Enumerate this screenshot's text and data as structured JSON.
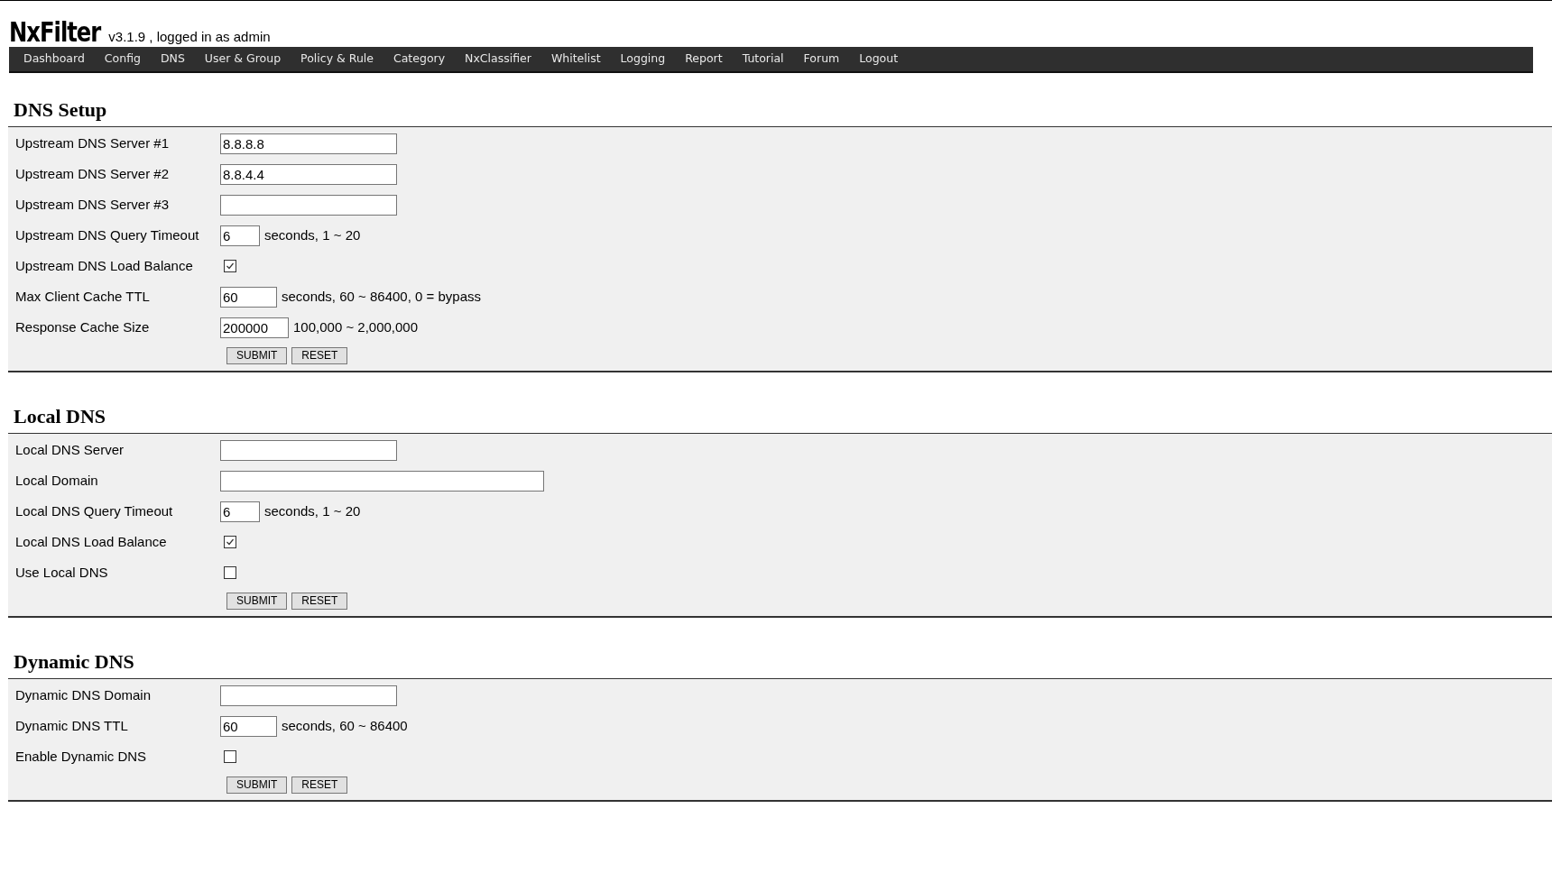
{
  "header": {
    "logo": "NxFilter",
    "info": "v3.1.9 , logged in as admin"
  },
  "nav": [
    "Dashboard",
    "Config",
    "DNS",
    "User & Group",
    "Policy & Rule",
    "Category",
    "NxClassifier",
    "Whitelist",
    "Logging",
    "Report",
    "Tutorial",
    "Forum",
    "Logout"
  ],
  "sections": [
    {
      "title": "DNS Setup",
      "rows": [
        {
          "kind": "text",
          "label": "Upstream DNS Server #1",
          "value": "8.8.8.8"
        },
        {
          "kind": "text",
          "label": "Upstream DNS Server #2",
          "value": "8.8.4.4"
        },
        {
          "kind": "text",
          "label": "Upstream DNS Server #3",
          "value": ""
        },
        {
          "kind": "number",
          "label": "Upstream DNS Query Timeout",
          "value": "6",
          "hint": "seconds, 1 ~ 20"
        },
        {
          "kind": "checkbox",
          "label": "Upstream DNS Load Balance",
          "checked": true
        },
        {
          "kind": "number",
          "label": "Max Client Cache TTL",
          "value": "60",
          "hint": "seconds, 60 ~ 86400, 0 = bypass"
        },
        {
          "kind": "number",
          "label": "Response Cache Size",
          "value": "200000",
          "hint": "100,000 ~ 2,000,000"
        }
      ],
      "buttons": [
        "SUBMIT",
        "RESET"
      ]
    },
    {
      "title": "Local DNS",
      "rows": [
        {
          "kind": "text",
          "label": "Local DNS Server",
          "value": ""
        },
        {
          "kind": "wide",
          "label": "Local Domain",
          "value": ""
        },
        {
          "kind": "number",
          "label": "Local DNS Query Timeout",
          "value": "6",
          "hint": "seconds, 1 ~ 20"
        },
        {
          "kind": "checkbox",
          "label": "Local DNS Load Balance",
          "checked": true
        },
        {
          "kind": "checkbox",
          "label": "Use Local DNS",
          "checked": false
        }
      ],
      "buttons": [
        "SUBMIT",
        "RESET"
      ]
    },
    {
      "title": "Dynamic DNS",
      "rows": [
        {
          "kind": "text",
          "label": "Dynamic DNS Domain",
          "value": ""
        },
        {
          "kind": "number",
          "label": "Dynamic DNS TTL",
          "value": "60",
          "hint": "seconds, 60 ~ 86400"
        },
        {
          "kind": "checkbox",
          "label": "Enable Dynamic DNS",
          "checked": false
        }
      ],
      "buttons": [
        "SUBMIT",
        "RESET"
      ]
    }
  ]
}
